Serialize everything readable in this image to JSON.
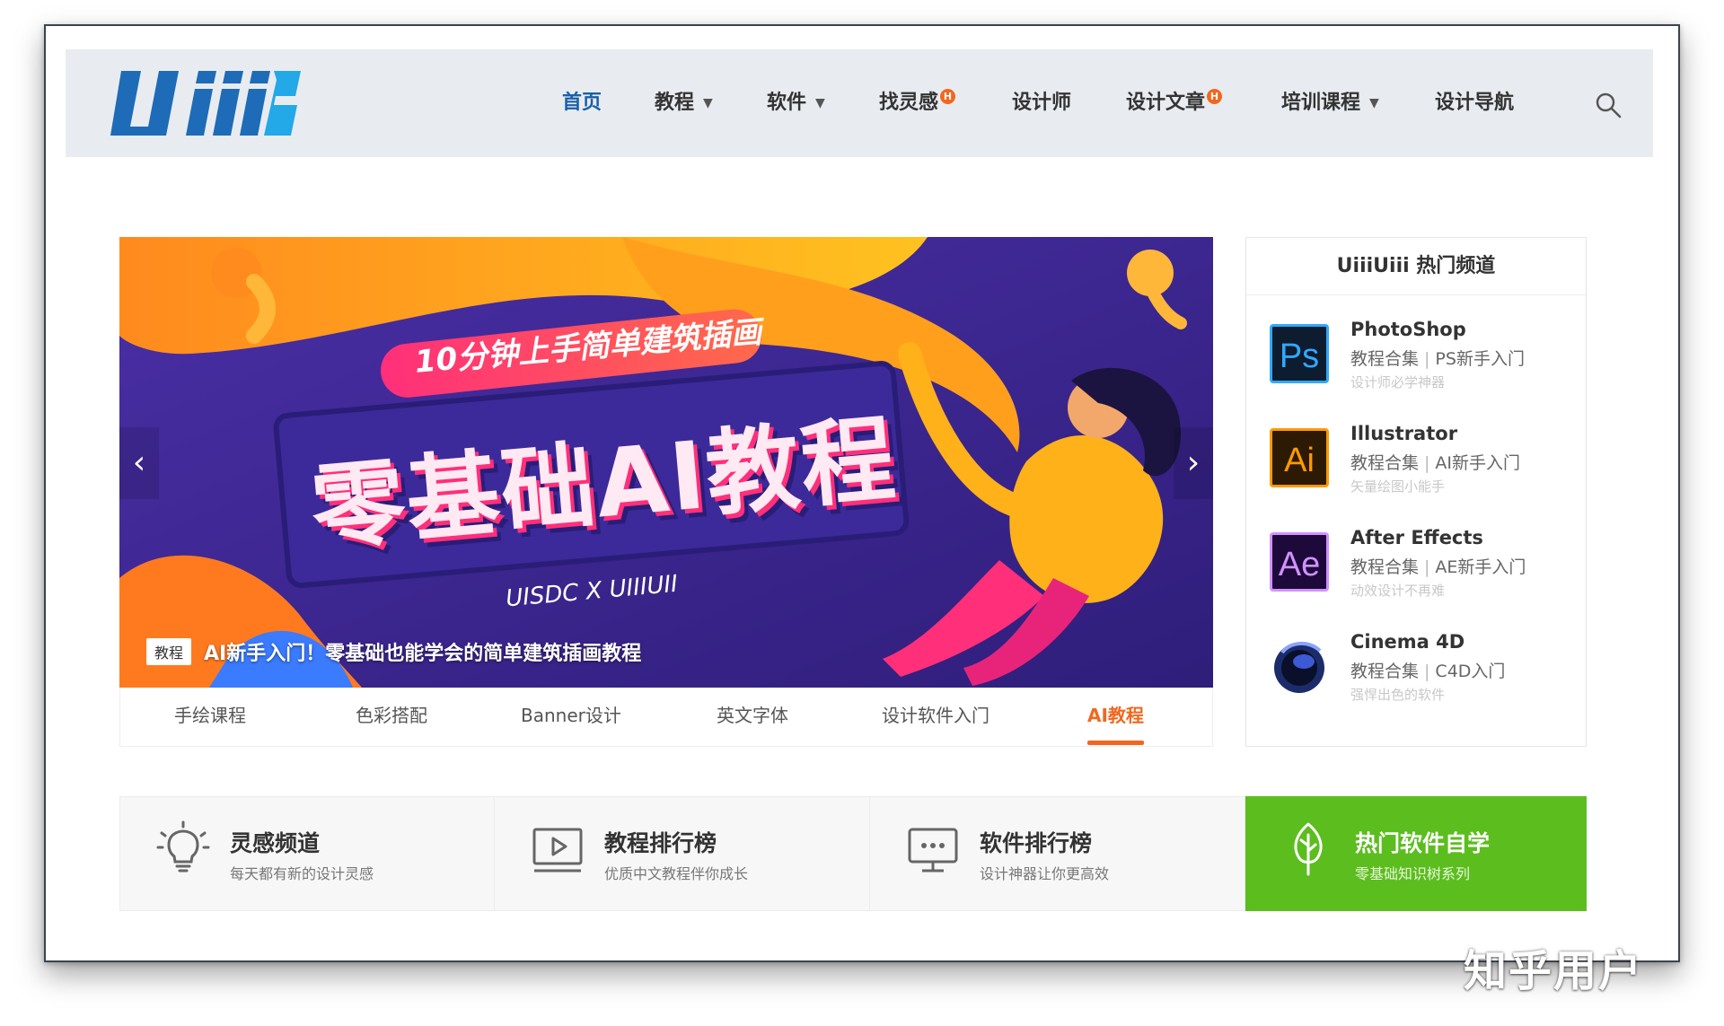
{
  "site": {
    "logo_text": "Uiiii"
  },
  "nav": {
    "items": [
      {
        "label": "首页",
        "active": true
      },
      {
        "label": "教程",
        "dropdown": true
      },
      {
        "label": "软件",
        "dropdown": true
      },
      {
        "label": "找灵感",
        "badge": "H"
      },
      {
        "label": "设计师"
      },
      {
        "label": "设计文章",
        "badge": "H"
      },
      {
        "label": "培训课程",
        "dropdown": true
      },
      {
        "label": "设计导航"
      }
    ],
    "search_icon": "search-icon"
  },
  "banner": {
    "headline_small": "10分钟上手简单建筑插画",
    "headline_big": "零基础AI教程",
    "credit": "UISDC X UIIIUII",
    "caption_tag": "教程",
    "caption_text": "AI新手入门！零基础也能学会的简单建筑插画教程",
    "prev_glyph": "‹",
    "next_glyph": "›"
  },
  "tabs": [
    {
      "label": "手绘课程"
    },
    {
      "label": "色彩搭配"
    },
    {
      "label": "Banner设计"
    },
    {
      "label": "英文字体"
    },
    {
      "label": "设计软件入门"
    },
    {
      "label": "AI教程",
      "active": true
    }
  ],
  "sidebar": {
    "title": "UiiiUiii 热门频道",
    "channels": [
      {
        "name": "PhotoShop",
        "link1": "教程合集",
        "link2": "PS新手入门",
        "desc": "设计师必学神器",
        "icon_text": "Ps",
        "icon_bg": "#0d1c2e",
        "icon_fg": "#31a8ff"
      },
      {
        "name": "Illustrator",
        "link1": "教程合集",
        "link2": "AI新手入门",
        "desc": "矢量绘图小能手",
        "icon_text": "Ai",
        "icon_bg": "#2d1a05",
        "icon_fg": "#ff9a00"
      },
      {
        "name": "After Effects",
        "link1": "教程合集",
        "link2": "AE新手入门",
        "desc": "动效设计不再难",
        "icon_text": "Ae",
        "icon_bg": "#1d0a3a",
        "icon_fg": "#d291ff"
      },
      {
        "name": "Cinema 4D",
        "link1": "教程合集",
        "link2": "C4D入门",
        "desc": "强悍出色的软件",
        "icon_text": "",
        "icon_bg": "#ffffff",
        "icon_fg": "#1c2c6a"
      }
    ]
  },
  "features": [
    {
      "title": "灵感频道",
      "sub": "每天都有新的设计灵感",
      "icon": "lightbulb-icon"
    },
    {
      "title": "教程排行榜",
      "sub": "优质中文教程伴你成长",
      "icon": "video-play-icon"
    },
    {
      "title": "软件排行榜",
      "sub": "设计神器让你更高效",
      "icon": "monitor-icon"
    },
    {
      "title": "热门软件自学",
      "sub": "零基础知识树系列",
      "icon": "leaf-icon",
      "highlight": true
    }
  ],
  "colors": {
    "accent_orange": "#f2671f",
    "nav_active_blue": "#1a5fa8",
    "feature_green": "#5cbd1f"
  },
  "watermark": "知乎用户"
}
